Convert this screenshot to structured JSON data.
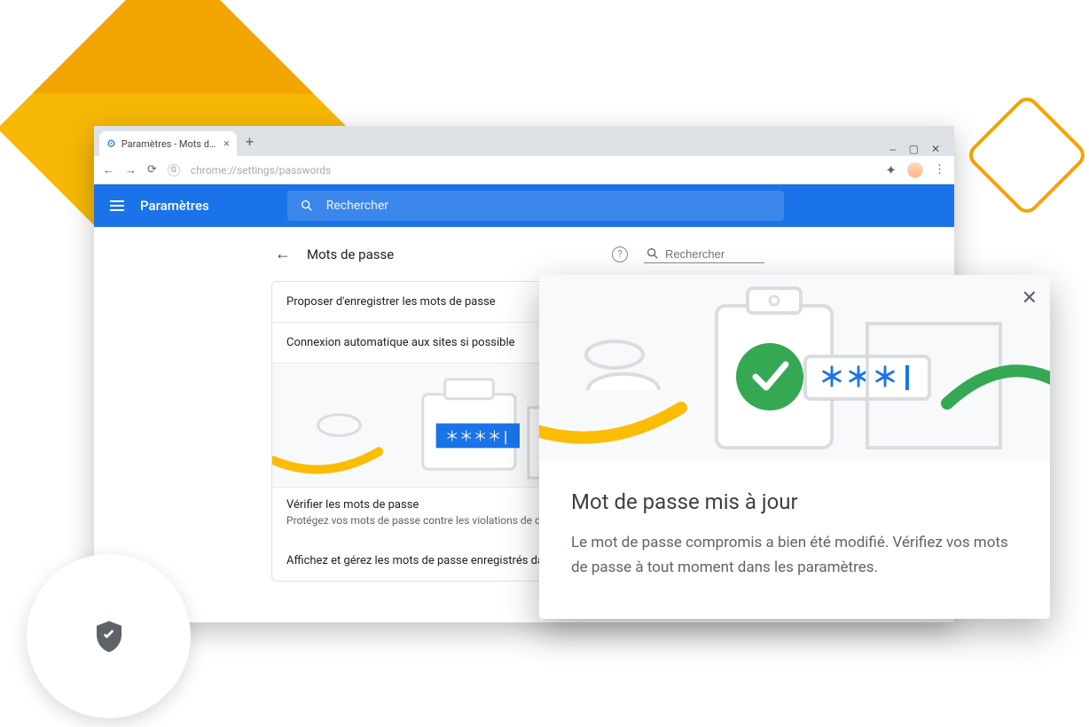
{
  "tab": {
    "title": "Paramètres - Mots de passe"
  },
  "address": {
    "url": "chrome://settings/passwords"
  },
  "header": {
    "title": "Paramètres",
    "search_placeholder": "Rechercher"
  },
  "panel": {
    "title": "Mots de passe",
    "search_placeholder": "Rechercher",
    "row_save": "Proposer d'enregistrer les mots de passe",
    "row_autoconnect": "Connexion automatique aux sites si possible",
    "check_title": "Vérifier les mots de passe",
    "check_sub": "Protégez vos mots de passe contre les violations de données",
    "row_manage": "Affichez et gérez les mots de passe enregistrés dans votre"
  },
  "modal": {
    "title": "Mot de passe mis à jour",
    "body": "Le mot de passe compromis a bien été modifié. Vérifiez vos mots de passe à tout moment dans les paramètres."
  }
}
